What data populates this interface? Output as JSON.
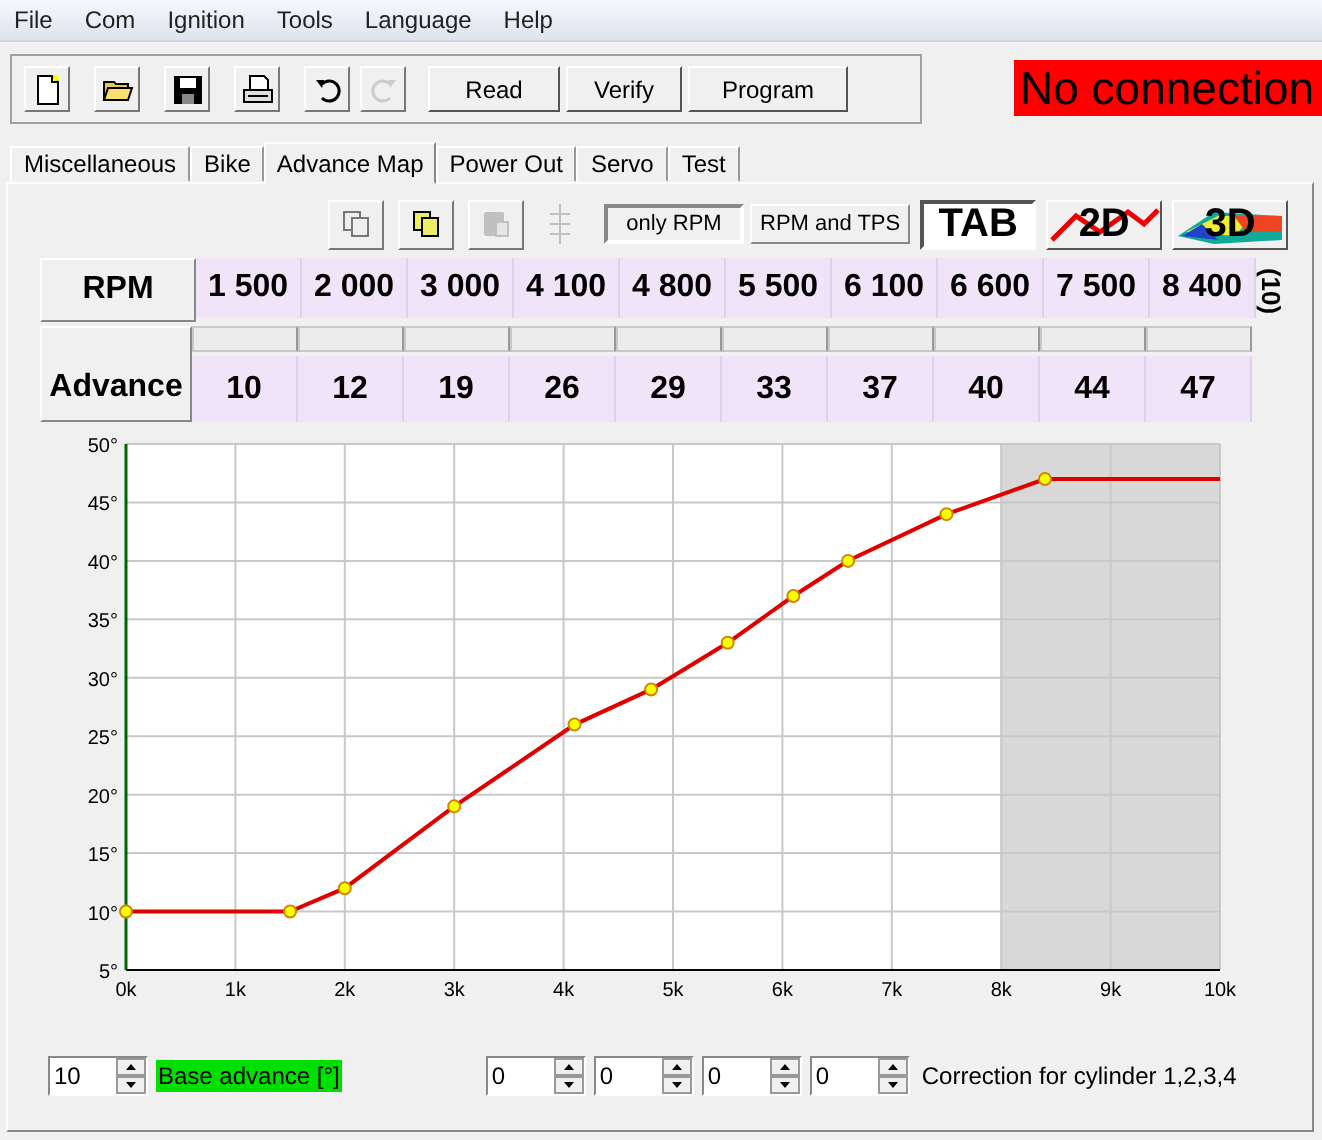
{
  "menu": [
    "File",
    "Com",
    "Ignition",
    "Tools",
    "Language",
    "Help"
  ],
  "toolbar": [
    {
      "kind": "new",
      "disabled": false
    },
    {
      "kind": "open",
      "disabled": false
    },
    {
      "kind": "save",
      "disabled": false
    },
    {
      "kind": "print",
      "disabled": false
    },
    {
      "kind": "undo",
      "disabled": false
    },
    {
      "kind": "redo",
      "disabled": true
    }
  ],
  "toolbar_buttons": [
    "Read",
    "Verify",
    "Program"
  ],
  "connection_status": "No connection",
  "tabs": [
    {
      "label": "Miscellaneous",
      "selected": false
    },
    {
      "label": "Bike",
      "selected": false
    },
    {
      "label": "Advance Map",
      "selected": true
    },
    {
      "label": "Power Out",
      "selected": false
    },
    {
      "label": "Servo",
      "selected": false
    },
    {
      "label": "Test",
      "selected": false
    }
  ],
  "map_tools": [
    {
      "kind": "copy",
      "disabled": false
    },
    {
      "kind": "paste",
      "disabled": false
    },
    {
      "kind": "clipboard",
      "disabled": true
    },
    {
      "kind": "insert",
      "disabled": true
    }
  ],
  "load_modes": [
    {
      "label": "only RPM",
      "selected": true
    },
    {
      "label": "RPM and TPS",
      "selected": false
    }
  ],
  "views": [
    {
      "label": "TAB",
      "kind": "table",
      "selected": true
    },
    {
      "label": "2D",
      "kind": "graph",
      "selected": false
    },
    {
      "label": "3D",
      "kind": "surface",
      "selected": false
    }
  ],
  "table": {
    "rpm_label": "RPM",
    "advance_label": "Advance",
    "rpm": [
      "1 500",
      "2 000",
      "3 000",
      "4 100",
      "4 800",
      "5 500",
      "6 100",
      "6 600",
      "7 500",
      "8 400"
    ],
    "advance": [
      "10",
      "12",
      "19",
      "26",
      "29",
      "33",
      "37",
      "40",
      "44",
      "47"
    ],
    "count": "(10)"
  },
  "chart_data": {
    "type": "line",
    "x": [
      0,
      1500,
      2000,
      3000,
      4100,
      4800,
      5500,
      6100,
      6600,
      7500,
      8400,
      10000
    ],
    "grid": true,
    "series": [
      {
        "color": "#e00000",
        "marker": "circle",
        "values": [
          10,
          10,
          12,
          19,
          26,
          29,
          33,
          37,
          40,
          44,
          47,
          47
        ]
      }
    ],
    "xlim": [
      0,
      10000
    ],
    "ylim": [
      5,
      50
    ],
    "xticks": [
      {
        "value": 0,
        "label": "0k"
      },
      {
        "value": 1000,
        "label": "1k"
      },
      {
        "value": 2000,
        "label": "2k"
      },
      {
        "value": 3000,
        "label": "3k"
      },
      {
        "value": 4000,
        "label": "4k"
      },
      {
        "value": 5000,
        "label": "5k"
      },
      {
        "value": 6000,
        "label": "6k"
      },
      {
        "value": 7000,
        "label": "7k"
      },
      {
        "value": 8000,
        "label": "8k"
      },
      {
        "value": 9000,
        "label": "9k"
      },
      {
        "value": 10000,
        "label": "10k"
      }
    ],
    "yticks": [
      {
        "value": 5,
        "label": "5°"
      },
      {
        "value": 10,
        "label": "10°"
      },
      {
        "value": 15,
        "label": "15°"
      },
      {
        "value": 20,
        "label": "20°"
      },
      {
        "value": 25,
        "label": "25°"
      },
      {
        "value": 30,
        "label": "30°"
      },
      {
        "value": 35,
        "label": "35°"
      },
      {
        "value": 40,
        "label": "40°"
      },
      {
        "value": 45,
        "label": "45°"
      },
      {
        "value": 50,
        "label": "50°"
      }
    ],
    "bands": [
      {
        "axis": "x",
        "from": 8000,
        "to": 10000
      }
    ]
  },
  "base_advance": {
    "value": "10",
    "label": "Base advance [°]"
  },
  "cylinder_corrections": [
    "0",
    "0",
    "0",
    "0"
  ],
  "correction_label": "Correction for cylinder 1,2,3,4"
}
